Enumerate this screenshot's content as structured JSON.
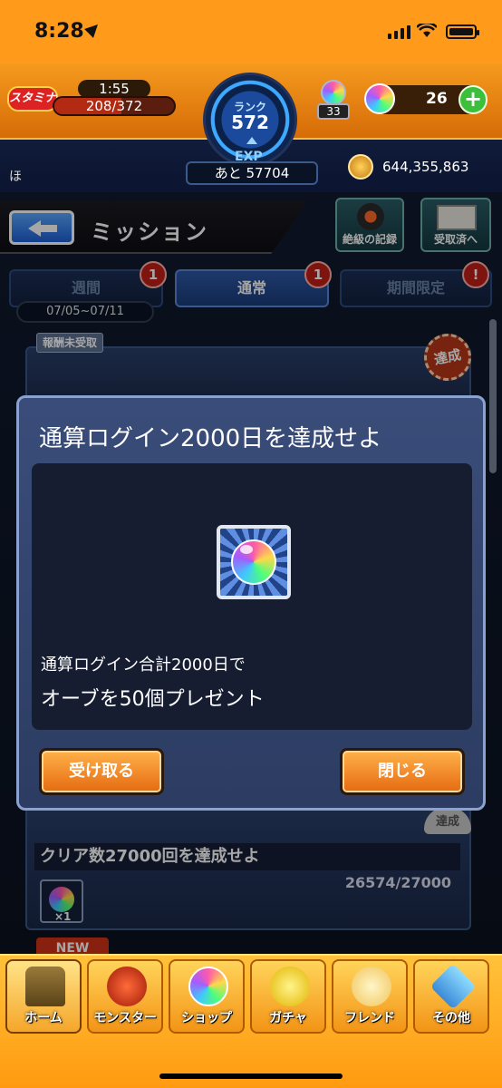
{
  "status_bar": {
    "time": "8:28"
  },
  "header": {
    "stamina_label": "スタミナ",
    "stamina_timer": "1:55",
    "stamina_value": "208/372",
    "stamina_fraction": 0.559,
    "rank_label": "ランク",
    "rank_value": "572",
    "exp_label": "EXP",
    "exp_remaining": "あと 57704",
    "orb_stock": "33",
    "orb_count": "26",
    "plus_label": "+",
    "player_name": "ほ",
    "coins": "644,355,863"
  },
  "page": {
    "title": "ミッション",
    "record_button": "絶級の記録",
    "received_button": "受取済へ"
  },
  "tabs": [
    {
      "label": "週間",
      "badge": "1"
    },
    {
      "label": "通常",
      "badge": "1"
    },
    {
      "label": "期間限定",
      "badge": "!"
    }
  ],
  "date_range": "07/05~07/11",
  "list": {
    "unclaimed_tag": "報酬未受取",
    "achieved_stamp": "達成",
    "card2_stamp": "達成",
    "card2_title": "クリア数27000回を達成せよ",
    "card2_progress": "26574/27000",
    "card2_reward_qty": "×1",
    "new_tag": "NEW"
  },
  "dialog": {
    "title": "通算ログイン2000日を達成せよ",
    "desc_line1": "通算ログイン合計2000日で",
    "desc_line2": "オーブを50個プレゼント",
    "receive_button": "受け取る",
    "close_button": "閉じる"
  },
  "nav": [
    {
      "label": "ホーム"
    },
    {
      "label": "モンスター"
    },
    {
      "label": "ショップ"
    },
    {
      "label": "ガチャ"
    },
    {
      "label": "フレンド"
    },
    {
      "label": "その他"
    }
  ]
}
